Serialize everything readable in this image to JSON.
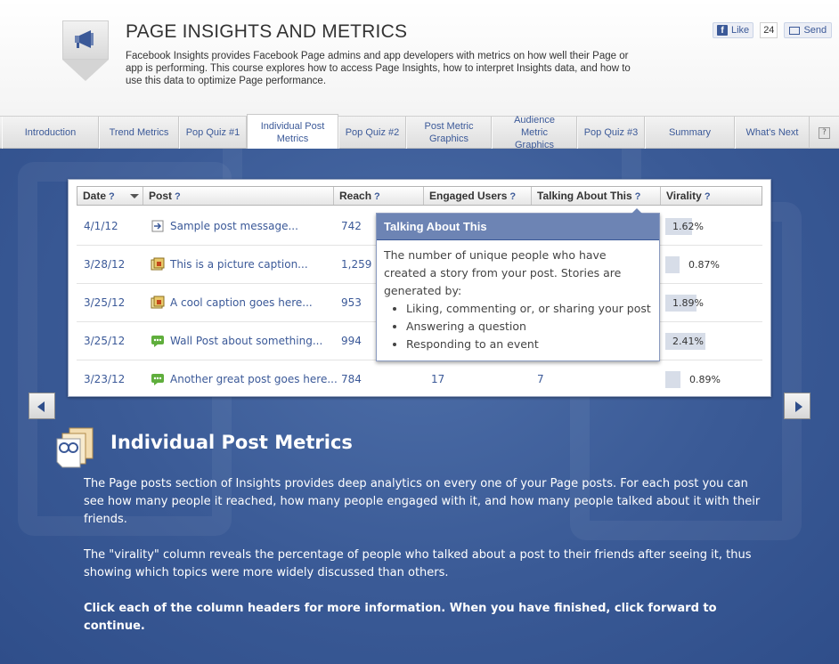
{
  "header": {
    "title": "PAGE INSIGHTS AND METRICS",
    "description": "Facebook Insights provides Facebook Page admins and app developers with metrics on how well their Page or app is performing. This course explores how to access Page Insights, how to interpret Insights data, and how to use this data to optimize Page performance.",
    "logo_icon": "megaphone-icon"
  },
  "social": {
    "like_label": "Like",
    "like_count": "24",
    "send_label": "Send"
  },
  "tabs": [
    {
      "label": "Introduction"
    },
    {
      "label": "Trend Metrics"
    },
    {
      "label": "Pop Quiz #1"
    },
    {
      "label": "Individual Post Metrics",
      "active": true
    },
    {
      "label": "Pop Quiz #2"
    },
    {
      "label": "Post Metric Graphics"
    },
    {
      "label": "Audience Metric Graphics"
    },
    {
      "label": "Pop Quiz #3"
    },
    {
      "label": "Summary"
    },
    {
      "label": "What's Next"
    }
  ],
  "help_label": "?",
  "table": {
    "columns": [
      {
        "label": "Date",
        "help": "?"
      },
      {
        "label": "Post",
        "help": "?"
      },
      {
        "label": "Reach",
        "help": "?"
      },
      {
        "label": "Engaged Users",
        "help": "?"
      },
      {
        "label": "Talking About This",
        "help": "?"
      },
      {
        "label": "Virality",
        "help": "?"
      }
    ],
    "rows": [
      {
        "date": "4/1/12",
        "icon": "link-icon",
        "post": "Sample post message...",
        "reach": "742",
        "engaged": "",
        "talking": "",
        "virality": "1.62%",
        "virality_value": 1.62
      },
      {
        "date": "3/28/12",
        "icon": "photo-icon",
        "post": "This is a picture caption...",
        "reach": "1,259",
        "engaged": "",
        "talking": "",
        "virality": "0.87%",
        "virality_value": 0.87
      },
      {
        "date": "3/25/12",
        "icon": "photo-icon",
        "post": "A cool caption goes here...",
        "reach": "953",
        "engaged": "",
        "talking": "",
        "virality": "1.89%",
        "virality_value": 1.89
      },
      {
        "date": "3/25/12",
        "icon": "status-icon",
        "post": "Wall Post about something...",
        "reach": "994",
        "engaged": "",
        "talking": "",
        "virality": "2.41%",
        "virality_value": 2.41
      },
      {
        "date": "3/23/12",
        "icon": "status-icon",
        "post": "Another great post goes here...",
        "reach": "784",
        "engaged": "17",
        "talking": "7",
        "virality": "0.89%",
        "virality_value": 0.89
      }
    ]
  },
  "tooltip": {
    "title": "Talking About This",
    "intro": "The number of unique people who have created a story from your post. Stories are generated by:",
    "items": [
      "Liking, commenting or, or sharing your post",
      "Answering a question",
      "Responding to an event"
    ]
  },
  "section": {
    "icon": "metrics-document-icon",
    "title": "Individual Post Metrics",
    "paragraphs": [
      "The Page posts section of Insights provides deep analytics on every one of your Page posts. For each post you can see how many people it reached, how many people engaged with it, and how many people talked about it with their friends.",
      "The \"virality\" column reveals the percentage of people who talked about a post to their friends after seeing it, thus showing which topics were more widely discussed than others.",
      "Click each of the column headers for more information. When you have finished, click forward to continue."
    ]
  },
  "colors": {
    "brand": "#3b5998",
    "background": "#3a5a96",
    "tooltip_header": "#6d84b4"
  }
}
